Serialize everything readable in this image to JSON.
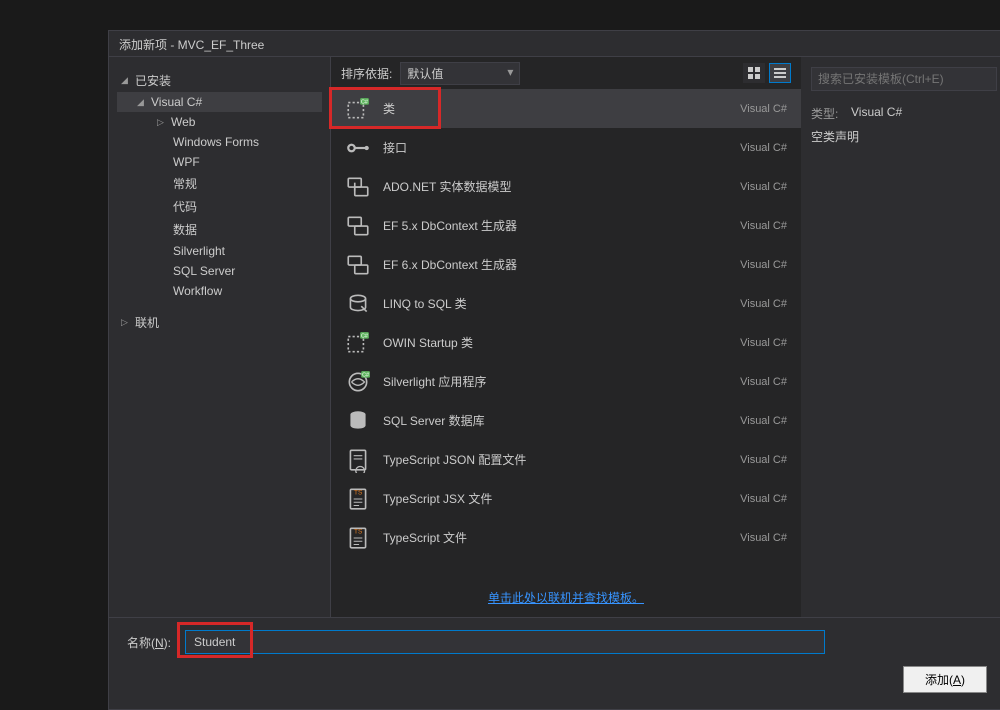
{
  "window": {
    "title": "添加新项 - MVC_EF_Three"
  },
  "tree": {
    "installed": "已安装",
    "visualcs": "Visual C#",
    "web": "Web",
    "winforms": "Windows Forms",
    "wpf": "WPF",
    "general": "常规",
    "code": "代码",
    "data": "数据",
    "silverlight": "Silverlight",
    "sqlserver": "SQL Server",
    "workflow": "Workflow",
    "online": "联机"
  },
  "sortbar": {
    "label": "排序依据:",
    "value": "默认值"
  },
  "templates": [
    {
      "name": "类",
      "lang": "Visual C#"
    },
    {
      "name": "接口",
      "lang": "Visual C#"
    },
    {
      "name": "ADO.NET 实体数据模型",
      "lang": "Visual C#"
    },
    {
      "name": "EF 5.x DbContext 生成器",
      "lang": "Visual C#"
    },
    {
      "name": "EF 6.x DbContext 生成器",
      "lang": "Visual C#"
    },
    {
      "name": "LINQ to SQL 类",
      "lang": "Visual C#"
    },
    {
      "name": "OWIN Startup 类",
      "lang": "Visual C#"
    },
    {
      "name": "Silverlight 应用程序",
      "lang": "Visual C#"
    },
    {
      "name": "SQL Server 数据库",
      "lang": "Visual C#"
    },
    {
      "name": "TypeScript JSON 配置文件",
      "lang": "Visual C#"
    },
    {
      "name": "TypeScript JSX 文件",
      "lang": "Visual C#"
    },
    {
      "name": "TypeScript 文件",
      "lang": "Visual C#"
    }
  ],
  "online_link": "单击此处以联机并查找模板。",
  "right": {
    "search_placeholder": "搜索已安装模板(Ctrl+E)",
    "type_label": "类型:",
    "type_value": "Visual C#",
    "desc": "空类声明"
  },
  "bottom": {
    "name_label_pre": "名称(",
    "name_label_ul": "N",
    "name_label_post": "):",
    "name_value": "Student",
    "add_pre": "添加(",
    "add_ul": "A",
    "add_post": ")"
  }
}
